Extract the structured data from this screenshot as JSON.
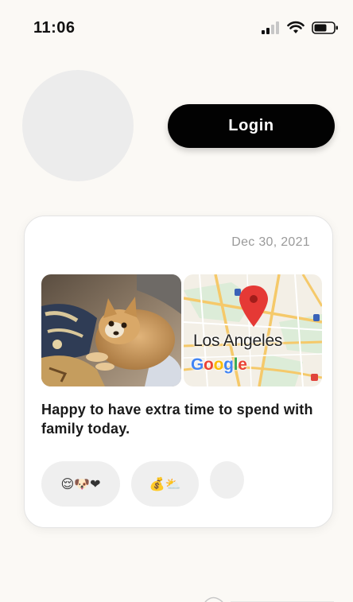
{
  "status_bar": {
    "time": "11:06",
    "icons": [
      "signal-icon",
      "wifi-icon",
      "battery-icon"
    ]
  },
  "header": {
    "login_label": "Login"
  },
  "post": {
    "date": "Dec 30, 2021",
    "media": [
      {
        "kind": "photo",
        "subject": "dog-photo"
      },
      {
        "kind": "map",
        "place_label": "Los Angeles",
        "logo_letters": [
          "G",
          "o",
          "o",
          "g",
          "l",
          "e"
        ]
      }
    ],
    "text": "Happy to have extra time to spend with family today.",
    "reactions": [
      {
        "emoji": "😌🐶❤"
      },
      {
        "emoji": "💰⛅"
      },
      {
        "emoji": ""
      }
    ]
  },
  "colors": {
    "background": "#fbf9f5",
    "login_bg": "#020202",
    "login_text": "#ffffff",
    "card_bg": "#ffffff",
    "date_text": "#9a9a9a",
    "reaction_bg": "#efefef",
    "avatar_bg": "#ececec",
    "map_pin": "#e53935"
  }
}
